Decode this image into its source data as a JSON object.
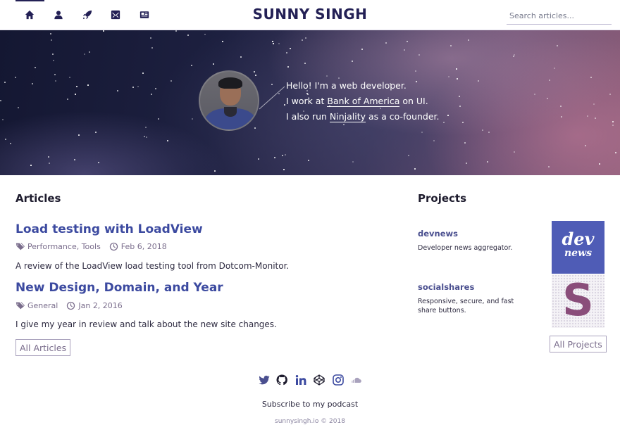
{
  "nav": {
    "brand": "SUNNY SINGH",
    "search_placeholder": "Search articles...",
    "icons": [
      "home-icon",
      "user-icon",
      "rocket-icon",
      "mail-icon",
      "newspaper-icon"
    ]
  },
  "hero": {
    "line1": "Hello! I'm a web developer.",
    "line2_pre": "I work at ",
    "line2_link": "Bank of America",
    "line2_post": " on UI.",
    "line3_pre": "I also run ",
    "line3_link": "Ninjality",
    "line3_post": " as a co-founder."
  },
  "articles": {
    "heading": "Articles",
    "items": [
      {
        "title": "Load testing with LoadView",
        "tags": "Performance, Tools",
        "date": "Feb 6, 2018",
        "description": "A review of the LoadView load testing tool from Dotcom-Monitor."
      },
      {
        "title": "New Design, Domain, and Year",
        "tags": "General",
        "date": "Jan 2, 2016",
        "description": "I give my year in review and talk about the new site changes."
      }
    ],
    "all_label": "All Articles"
  },
  "projects": {
    "heading": "Projects",
    "items": [
      {
        "name": "devnews",
        "description": "Developer news aggregator.",
        "logo_line1": "dev",
        "logo_line2": "news"
      },
      {
        "name": "socialshares",
        "description": "Responsive, secure, and fast share buttons.",
        "logo_letter": "S"
      }
    ],
    "all_label": "All Projects"
  },
  "footer": {
    "social_icons": [
      "twitter-icon",
      "github-icon",
      "linkedin-icon",
      "codepen-icon",
      "instagram-icon",
      "soundcloud-icon"
    ],
    "podcast_label": "Subscribe to my podcast",
    "copyright": "sunnysingh.io © 2018"
  },
  "colors": {
    "brand": "#232055",
    "link": "#3c4aa0",
    "muted": "#7a6d8c",
    "devnews_bg": "#4f5cb6",
    "socialshares_fg": "#8a4d7a"
  }
}
